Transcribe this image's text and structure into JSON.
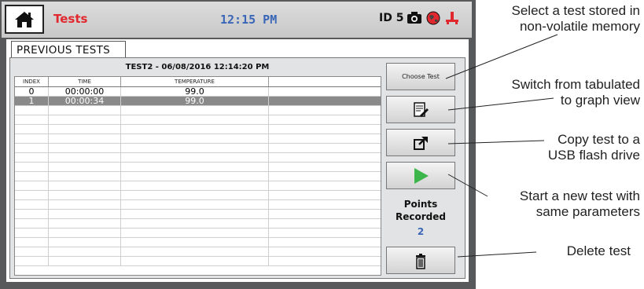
{
  "header": {
    "title": "Tests",
    "time": "12:15 PM",
    "id_label": "ID 5",
    "icons": [
      "home-icon",
      "camera-icon",
      "globe-icon",
      "usb-icon"
    ]
  },
  "tab": {
    "label": "PREVIOUS TESTS"
  },
  "test_title": "TEST2 - 06/08/2016 12:14:20 PM",
  "table": {
    "columns": [
      "INDEX",
      "TIME",
      "TEMPERATURE",
      ""
    ],
    "rows": [
      [
        "0",
        "00:00:00",
        "99.0",
        ""
      ],
      [
        "1",
        "00:00:34",
        "99.0",
        ""
      ]
    ],
    "selected_row": 1
  },
  "sidebar": {
    "choose_test_label": "Choose Test",
    "graph_view_icon": "graph-view-icon",
    "export_icon": "export-icon",
    "start_icon": "play-icon",
    "delete_icon": "trash-icon",
    "points_label_1": "Points",
    "points_label_2": "Recorded",
    "points_value": "2"
  },
  "callouts": {
    "choose_1": "Select a test stored in",
    "choose_2": "non-volatile memory",
    "switch_1": "Switch from tabulated",
    "switch_2": "to graph view",
    "copy_1": "Copy test to a",
    "copy_2": "USB flash drive",
    "start_1": "Start a new test with",
    "start_2": "same parameters",
    "delete_1": "Delete test"
  },
  "colors": {
    "title_red": "#e0282e",
    "time_blue": "#3a66b7",
    "play_green": "#3cb54a",
    "frame": "#58595b",
    "selected_row": "#8a8a8a"
  }
}
